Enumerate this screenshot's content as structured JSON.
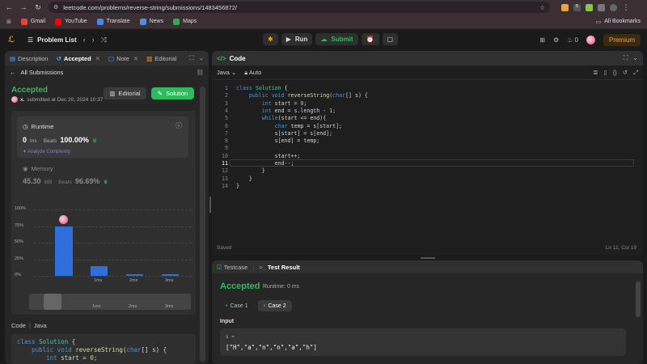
{
  "browser": {
    "url": "leetcode.com/problems/reverse-string/submissions/1483456872/",
    "bookmarks": [
      {
        "label": "Gmail",
        "color": "#ea4335"
      },
      {
        "label": "YouTube",
        "color": "#ff0000"
      },
      {
        "label": "Translate",
        "color": "#4285f4"
      },
      {
        "label": "News",
        "color": "#4a90e2"
      },
      {
        "label": "Maps",
        "color": "#34a853"
      }
    ],
    "all_bookmarks": "All Bookmarks",
    "ext_badge": "5"
  },
  "toolbar": {
    "problem_list": "Problem List",
    "run": "Run",
    "submit": "Submit",
    "streak": "0",
    "premium": "Premium"
  },
  "left": {
    "tabs": [
      "Description",
      "Accepted",
      "Note",
      "Editorial"
    ],
    "all_submissions": "All Submissions",
    "status": "Accepted",
    "user": "x.",
    "submitted_at": "submitted at Dec 20, 2024 10:37",
    "editorial_btn": "Editorial",
    "solution_btn": "Solution",
    "runtime_label": "Runtime",
    "runtime_value": "0",
    "runtime_unit": "ms",
    "beats_label": "Beats",
    "runtime_beats": "100.00%",
    "analyze": "Analyze Complexity",
    "memory_label": "Memory",
    "memory_value": "45.30",
    "memory_unit": "MB",
    "memory_beats": "96.69%",
    "code_label": "Code",
    "code_lang": "Java",
    "code_preview": [
      "class Solution {",
      "    public void reverseString(char[] s) {",
      "        int start = 0;"
    ]
  },
  "chart_data": {
    "type": "bar",
    "yticks": [
      "100%",
      "75%",
      "50%",
      "25%",
      "0%"
    ],
    "ylim": [
      0,
      100
    ],
    "categories": [
      "0ms",
      "1ms",
      "2ms",
      "3ms"
    ],
    "xlabels_shown": [
      "",
      "1ms",
      "2ms",
      "3ms"
    ],
    "values": [
      75,
      15,
      3,
      3
    ],
    "slider_labels": [
      "1ms",
      "2ms",
      "3ms"
    ],
    "bar_color": "#2f6fdc"
  },
  "code_panel": {
    "title": "Code",
    "lang": "Java",
    "mode": "Auto",
    "lines": [
      "class Solution {",
      "    public void reverseString(char[] s) {",
      "        int start = 0;",
      "        int end = s.length - 1;",
      "        while(start <= end){",
      "            char temp = s[start];",
      "            s[start] = s[end];",
      "            s[end] = temp;",
      "",
      "            start++;",
      "            end--;",
      "        }",
      "    }",
      "}"
    ],
    "current_line": 11,
    "saved": "Saved",
    "cursor": "Ln 11, Col 19"
  },
  "test_panel": {
    "tab_testcase": "Testcase",
    "tab_result": "Test Result",
    "status": "Accepted",
    "runtime": "Runtime: 0 ms",
    "case1": "Case 1",
    "case2": "Case 2",
    "input_label": "Input",
    "var": "s =",
    "value": "[\"H\",\"a\",\"n\",\"n\",\"a\",\"h\"]"
  }
}
